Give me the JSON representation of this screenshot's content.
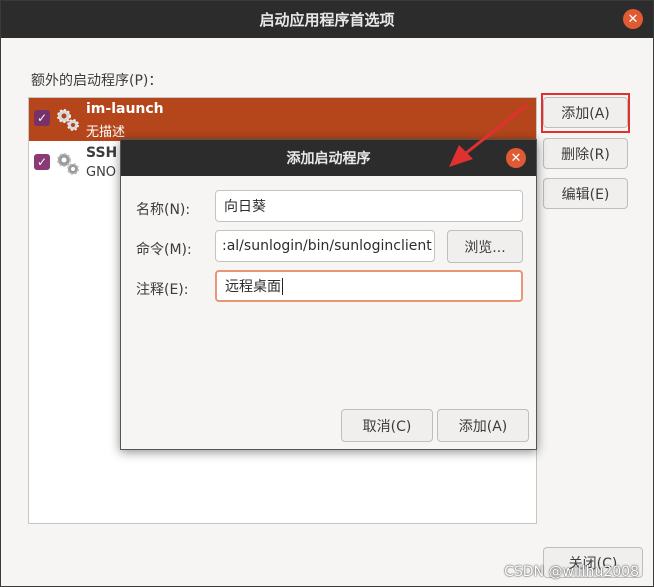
{
  "window": {
    "title": "启动应用程序首选项",
    "close_glyph": "✕"
  },
  "list": {
    "label": "额外的启动程序(P)：",
    "items": [
      {
        "name": "im-launch",
        "description": "无描述",
        "checked": true,
        "selected": true,
        "icon": "gears-icon"
      },
      {
        "name": "SSH",
        "description": "GNO",
        "checked": true,
        "selected": false,
        "icon": "gears-icon"
      }
    ]
  },
  "side_buttons": {
    "add": "添加(A)",
    "remove": "删除(R)",
    "edit": "编辑(E)",
    "close": "关闭(C)"
  },
  "dialog": {
    "title": "添加启动程序",
    "close_glyph": "✕",
    "name_label": "名称(N):",
    "name_value": "向日葵",
    "command_label": "命令(M):",
    "command_value": ":al/sunlogin/bin/sunloginclient",
    "browse_label": "浏览...",
    "comment_label": "注释(E):",
    "comment_value": "远程桌面",
    "cancel_label": "取消(C)",
    "add_label": "添加(A)"
  },
  "checkmark": "✓",
  "colors": {
    "selection": "#b5461c",
    "checkbox": "#8a3a74",
    "close_button": "#e05a33",
    "annotation": "#e03030"
  },
  "watermark": "CSDN @willhu2008"
}
